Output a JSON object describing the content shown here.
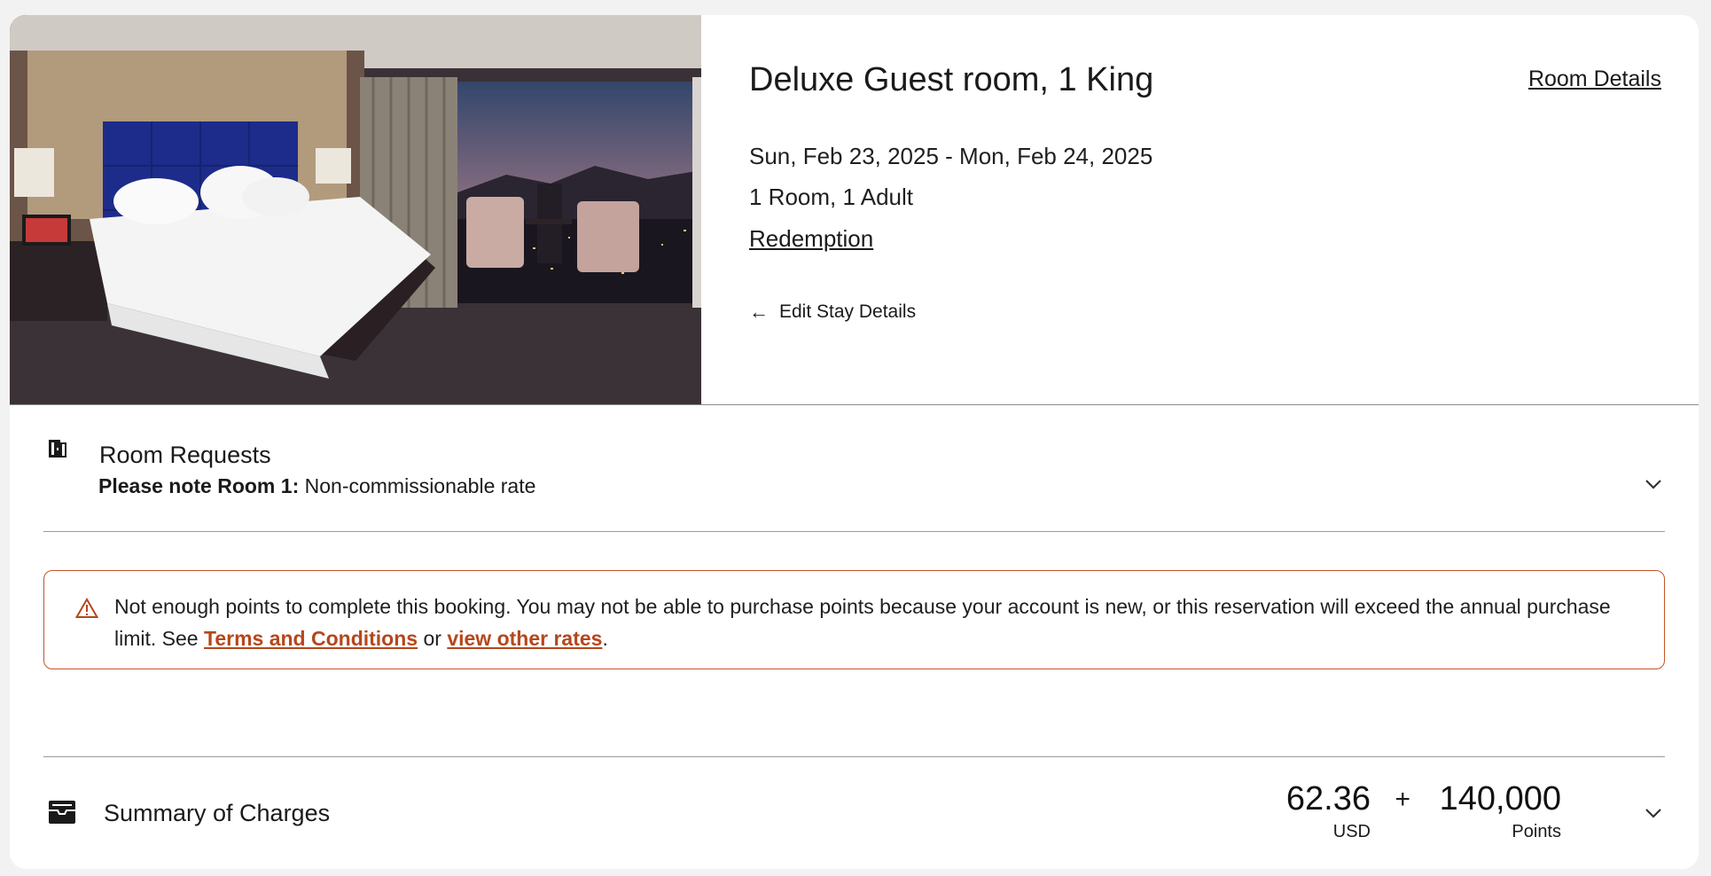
{
  "room": {
    "title": "Deluxe Guest room, 1 King",
    "details_link": "Room Details",
    "dates": "Sun, Feb 23, 2025 - Mon, Feb 24, 2025",
    "occupancy": "1 Room, 1 Adult",
    "rate_type": "Redemption",
    "edit_label": "Edit Stay Details"
  },
  "requests": {
    "title": "Room Requests",
    "note_label": "Please note Room 1:",
    "note_text": "Non-commissionable rate"
  },
  "alert": {
    "text_before": "Not enough points to complete this booking. You may not be able to purchase points because your account is new, or this reservation will exceed the annual purchase limit. See ",
    "terms_link": "Terms and Conditions",
    "text_middle": " or ",
    "rates_link": "view other rates",
    "text_after": ".",
    "color": "#b5471c"
  },
  "summary": {
    "title": "Summary of Charges",
    "cash_amount": "62.36",
    "cash_unit": "USD",
    "plus": "+",
    "points_amount": "140,000",
    "points_unit": "Points"
  },
  "icons": {
    "door": "door-icon",
    "warning": "warning-icon",
    "summary": "inbox-icon",
    "chevron": "chevron-down-icon",
    "back": "arrow-left-icon"
  }
}
